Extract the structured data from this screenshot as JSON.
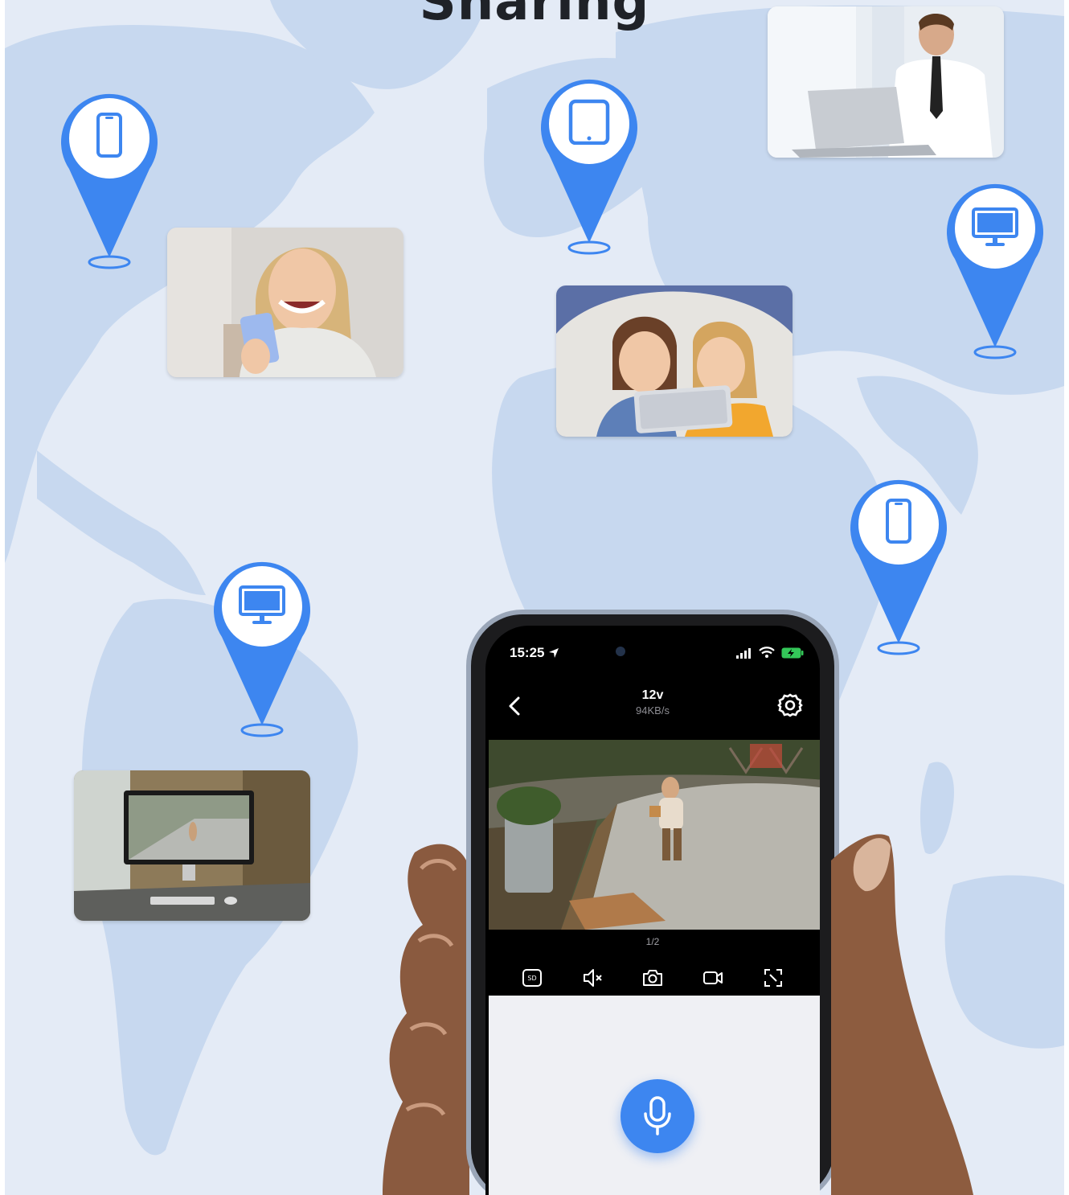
{
  "banner": {
    "headline": "Sharing"
  },
  "colors": {
    "background": "#e4ebf6",
    "map_land": "#c7d8ef",
    "pin_blue": "#3d86f0",
    "mic_blue": "#3d86f0",
    "battery_green": "#34c759"
  },
  "location_pins": [
    {
      "icon": "smartphone-icon"
    },
    {
      "icon": "tablet-icon"
    },
    {
      "icon": "monitor-icon"
    },
    {
      "icon": "smartphone-icon"
    },
    {
      "icon": "monitor-icon"
    }
  ],
  "phone_app": {
    "status_bar": {
      "time": "15:25",
      "icons": [
        "location-arrow-icon",
        "cellular-signal-icon",
        "wifi-icon",
        "battery-charging-icon"
      ]
    },
    "header": {
      "title": "12v",
      "data_rate": "94KB/s",
      "back_icon": "chevron-left-icon",
      "settings_icon": "gear-icon"
    },
    "page_indicator": "1/2",
    "controls": [
      "sd-card-icon",
      "mute-icon",
      "camera-icon",
      "record-video-icon",
      "fullscreen-icon"
    ],
    "talk_button_icon": "microphone-icon"
  }
}
